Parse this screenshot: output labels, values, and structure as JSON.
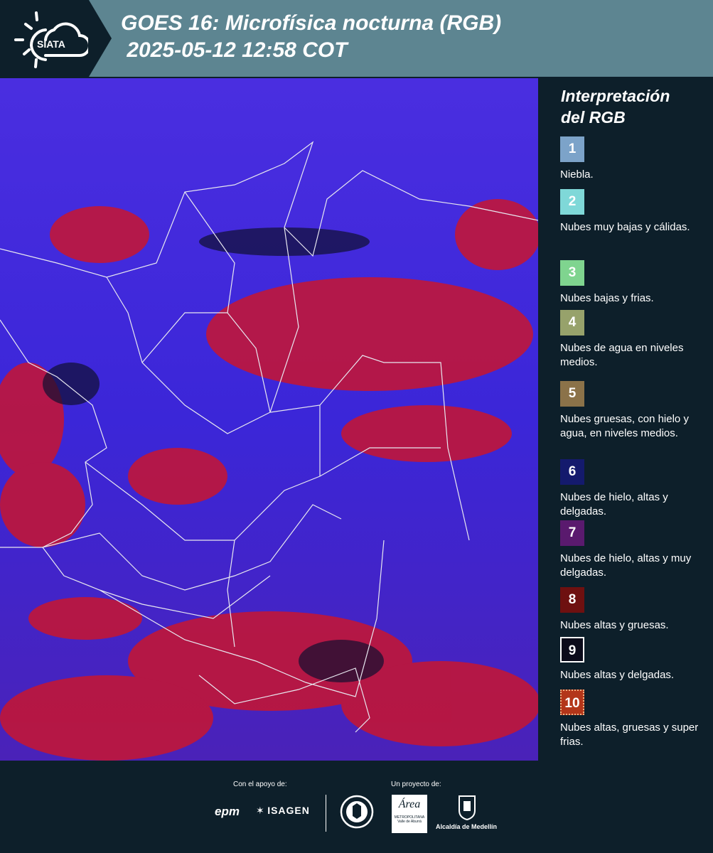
{
  "header": {
    "brand": "SIATA",
    "title_line1": "GOES 16: Microfísica nocturna (RGB)",
    "title_line2": " 2025-05-12 12:58 COT"
  },
  "legend": {
    "title_line1": "Interpretación",
    "title_line2": "del RGB",
    "items": [
      {
        "num": "1",
        "label": "Niebla.",
        "color": "#7ca3c9"
      },
      {
        "num": "2",
        "label": "Nubes muy bajas y cálidas.",
        "color": "#7fd8d8"
      },
      {
        "num": "3",
        "label": "Nubes bajas y frias.",
        "color": "#7fd48f"
      },
      {
        "num": "4",
        "label": "Nubes de agua en niveles medios.",
        "color": "#97a26b"
      },
      {
        "num": "5",
        "label": "Nubes gruesas, con hielo y agua, en niveles medios.",
        "color": "#8b7249"
      },
      {
        "num": "6",
        "label": "Nubes de hielo, altas y delgadas.",
        "color": "#141a6d"
      },
      {
        "num": "7",
        "label": "Nubes de hielo, altas y muy delgadas.",
        "color": "#5a1a6e"
      },
      {
        "num": "8",
        "label": "Nubes altas y gruesas.",
        "color": "#6e1010"
      },
      {
        "num": "9",
        "label": "Nubes altas y delgadas.",
        "color": "#0b0b1a"
      },
      {
        "num": "10",
        "label": "Nubes altas, gruesas y super frias.",
        "color": "#b3361a"
      }
    ]
  },
  "footer": {
    "support_label": "Con el apoyo de:",
    "project_label": "Un proyecto de:",
    "sponsor_epm": "epm",
    "sponsor_isagen": "ISAGEN",
    "partner_area_name": "Área",
    "partner_area_sub1": "METROPOLITANA",
    "partner_area_sub2": "Valle de Aburrá",
    "partner_alcaldia": "Alcaldía de Medellín"
  }
}
